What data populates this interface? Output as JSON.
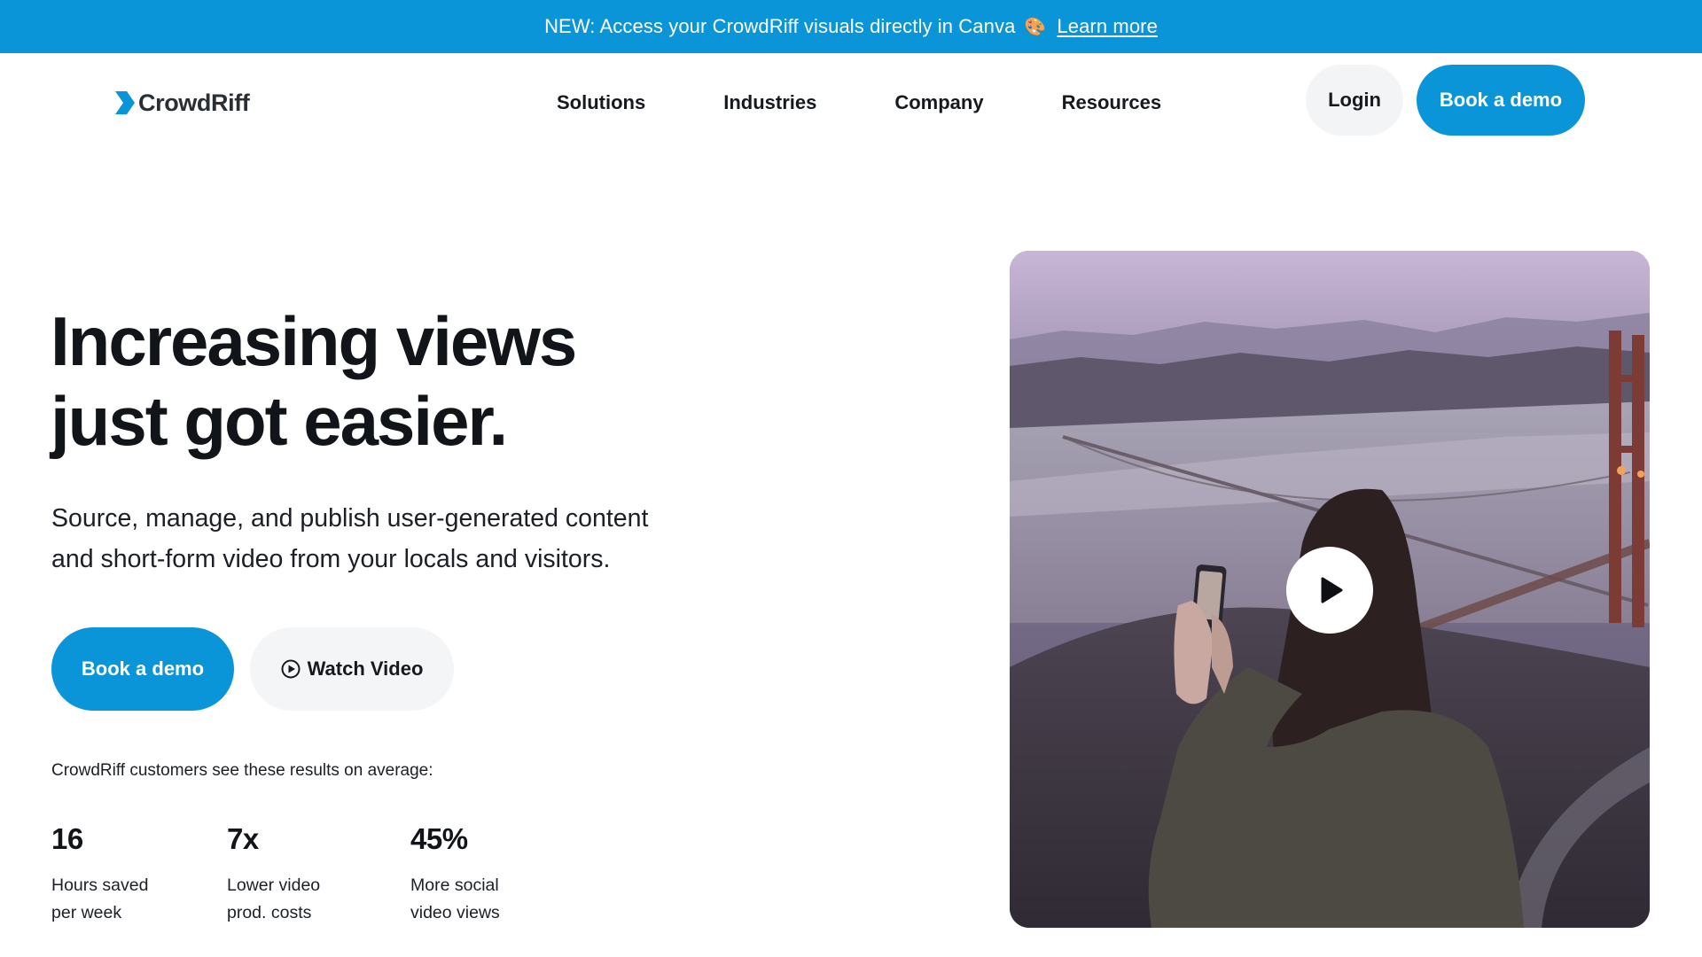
{
  "announcement": {
    "text": "NEW: Access your CrowdRiff visuals directly in Canva",
    "icon": "palette-icon",
    "link_label": "Learn more"
  },
  "header": {
    "logo_text": "CrowdRiff",
    "nav": [
      "Solutions",
      "Industries",
      "Company",
      "Resources"
    ],
    "login_label": "Login",
    "demo_label": "Book a demo"
  },
  "hero": {
    "title_line1": "Increasing views",
    "title_line2": "just got easier.",
    "subtitle_line1": "Source, manage, and publish user-generated content",
    "subtitle_line2": "and short-form video from your locals and visitors.",
    "primary_cta": "Book a demo",
    "video_cta": "Watch Video",
    "stats_intro": "CrowdRiff customers see these results on average:",
    "stats": [
      {
        "value": "16",
        "label": "Hours saved\nper week"
      },
      {
        "value": "7x",
        "label": "Lower video\nprod. costs"
      },
      {
        "value": "45%",
        "label": "More social\nvideo views"
      }
    ]
  },
  "video": {
    "play_icon": "play-icon"
  },
  "colors": {
    "brand": "#0b95d9",
    "text": "#111418",
    "button_gray": "#f2f4f6"
  }
}
